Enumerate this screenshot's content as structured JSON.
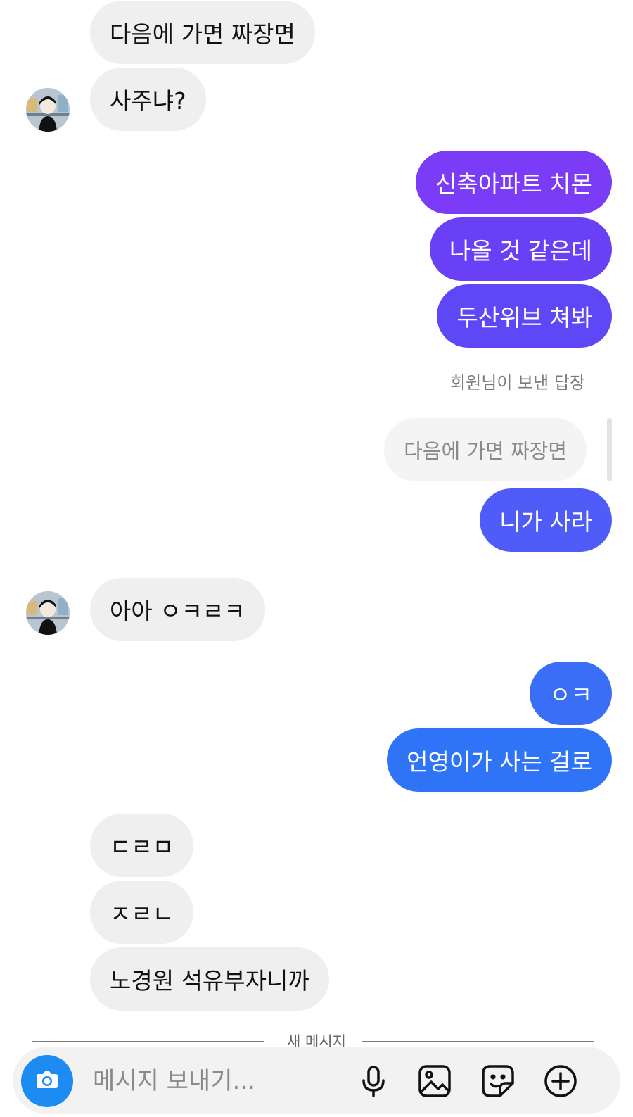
{
  "messages": {
    "m1": "다음에 가면 짜장면",
    "m2": "사주냐?",
    "m3": "신축아파트 치몬",
    "m4": "나올 것 같은데",
    "m5": "두산위브 쳐봐",
    "reply_label": "회원님이 보낸 답장",
    "reply_quote": "다음에 가면 짜장면",
    "m6": "니가 사라",
    "m7": "아아 ㅇㅋㄹㅋ",
    "m8": "ㅇㅋ",
    "m9": "언영이가 사는 걸로",
    "m10": "ㄷㄹㅁ",
    "m11": "ㅈㄹㄴ",
    "m12": "노경원 석유부자니까"
  },
  "divider": {
    "label": "새 메시지"
  },
  "composer": {
    "placeholder": "메시지 보내기...",
    "icons": [
      "camera-icon",
      "microphone-icon",
      "image-icon",
      "sticker-icon",
      "plus-circle-icon"
    ]
  },
  "colors": {
    "incoming_bg": "#efefef",
    "outgoing_gradient": [
      "#7a3cf6",
      "#5d47f6",
      "#4f5cf7",
      "#2f74f7"
    ],
    "camera_button": "#1c8cf2"
  }
}
